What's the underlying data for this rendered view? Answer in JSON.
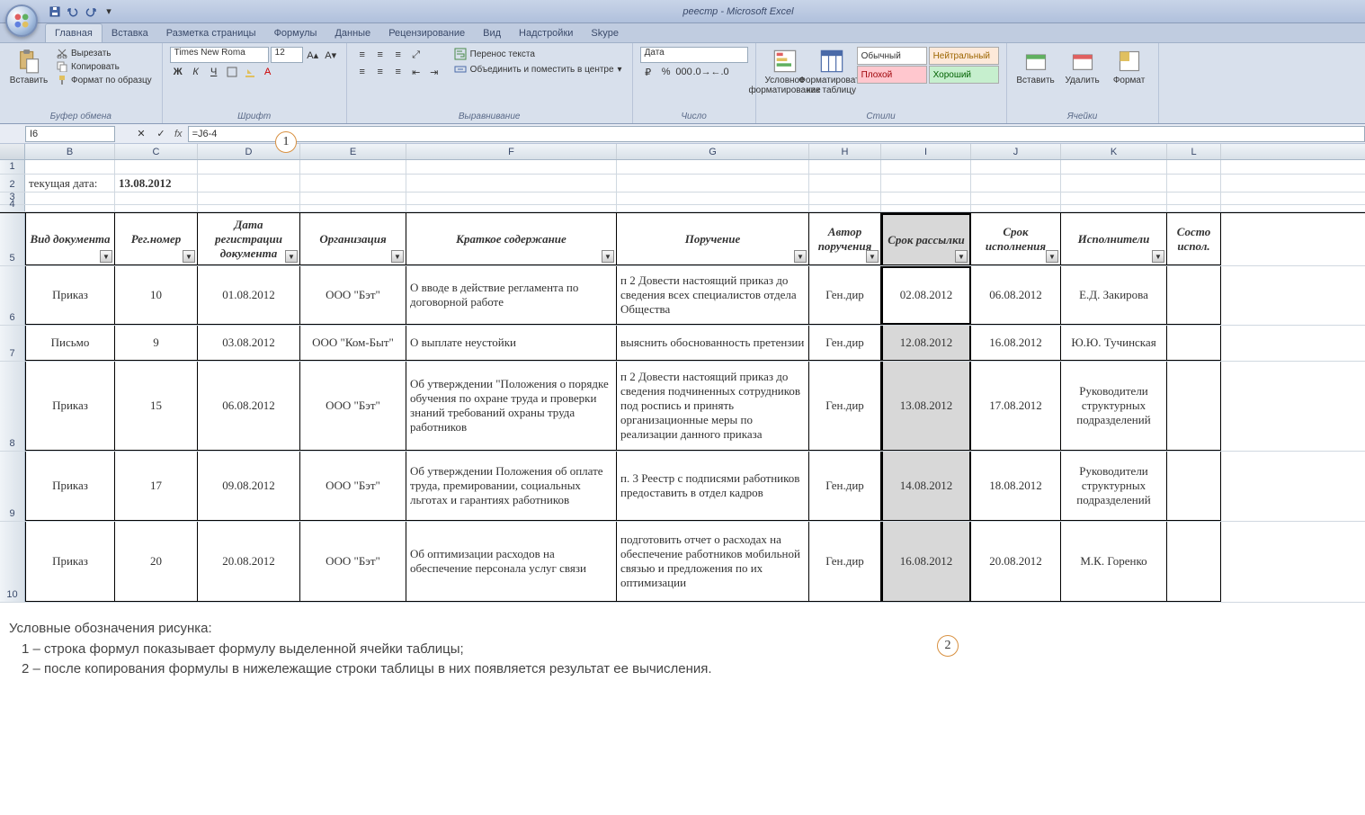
{
  "app_title": "реестр - Microsoft Excel",
  "tabs": [
    "Главная",
    "Вставка",
    "Разметка страницы",
    "Формулы",
    "Данные",
    "Рецензирование",
    "Вид",
    "Надстройки",
    "Skype"
  ],
  "ribbon": {
    "clipboard": {
      "paste": "Вставить",
      "cut": "Вырезать",
      "copy": "Копировать",
      "format_painter": "Формат по образцу",
      "label": "Буфер обмена"
    },
    "font": {
      "name": "Times New Roma",
      "size": "12",
      "label": "Шрифт"
    },
    "alignment": {
      "wrap": "Перенос текста",
      "merge": "Объединить и поместить в центре",
      "label": "Выравнивание"
    },
    "number": {
      "format": "Дата",
      "label": "Число"
    },
    "styles": {
      "cond": "Условное форматирование",
      "table": "Форматировать как таблицу",
      "normal": "Обычный",
      "neutral": "Нейтральный",
      "bad": "Плохой",
      "good": "Хороший",
      "label": "Стили"
    },
    "cells": {
      "insert": "Вставить",
      "delete": "Удалить",
      "format": "Формат",
      "label": "Ячейки"
    }
  },
  "namebox": "I6",
  "formula": "=J6-4",
  "columns": [
    "B",
    "C",
    "D",
    "E",
    "F",
    "G",
    "H",
    "I",
    "J",
    "K",
    "L"
  ],
  "meta_row": {
    "label": "текущая дата:",
    "value": "13.08.2012"
  },
  "headers": [
    "Вид документа",
    "Рег.номер",
    "Дата регистрации документа",
    "Организация",
    "Краткое содержание",
    "Поручение",
    "Автор поручения",
    "Срок рассылки",
    "Срок исполнения",
    "Исполнители",
    "Состо испол."
  ],
  "rows": [
    {
      "r": "6",
      "c": [
        "Приказ",
        "10",
        "01.08.2012",
        "ООО \"Бэт\"",
        "О вводе в действие регламента по договорной работе",
        "п 2 Довести настоящий приказ до сведения всех специалистов отдела Общества",
        "Ген.дир",
        "02.08.2012",
        "06.08.2012",
        "Е.Д. Закирова",
        ""
      ]
    },
    {
      "r": "7",
      "c": [
        "Письмо",
        "9",
        "03.08.2012",
        "ООО \"Ком-Быт\"",
        "О выплате неустойки",
        "выяснить обоснованность претензии",
        "Ген.дир",
        "12.08.2012",
        "16.08.2012",
        "Ю.Ю. Тучинская",
        ""
      ]
    },
    {
      "r": "8",
      "c": [
        "Приказ",
        "15",
        "06.08.2012",
        "ООО \"Бэт\"",
        "Об утверждении \"Положения о порядке обучения по охране труда и проверки знаний требований охраны труда работников",
        "п 2 Довести настоящий приказ до сведения подчиненных сотрудников под роспись и принять организационные меры по реализации данного приказа",
        "Ген.дир",
        "13.08.2012",
        "17.08.2012",
        "Руководители структурных подразделений",
        ""
      ]
    },
    {
      "r": "9",
      "c": [
        "Приказ",
        "17",
        "09.08.2012",
        "ООО \"Бэт\"",
        "Об утверждении Положения об оплате труда, премировании, социальных льготах и гарантиях работников",
        "п. 3 Реестр с подписями работников предоставить в отдел кадров",
        "Ген.дир",
        "14.08.2012",
        "18.08.2012",
        "Руководители структурных подразделений",
        ""
      ]
    },
    {
      "r": "10",
      "c": [
        "Приказ",
        "20",
        "20.08.2012",
        "ООО \"Бэт\"",
        "Об оптимизации расходов на обеспечение персонала услуг связи",
        "подготовить отчет о расходах на обеспечение работников мобильной связью и предложения по их оптимизации",
        "Ген.дир",
        "16.08.2012",
        "20.08.2012",
        "М.К. Горенко",
        ""
      ]
    }
  ],
  "legend": {
    "title": "Условные обозначения рисунка:",
    "l1": "1 – строка формул показывает формулу выделенной ячейки таблицы;",
    "l2": "2 – после копирования формулы в нижележащие строки таблицы в них появляется результат ее вычисления."
  },
  "callout1": "1",
  "callout2": "2"
}
